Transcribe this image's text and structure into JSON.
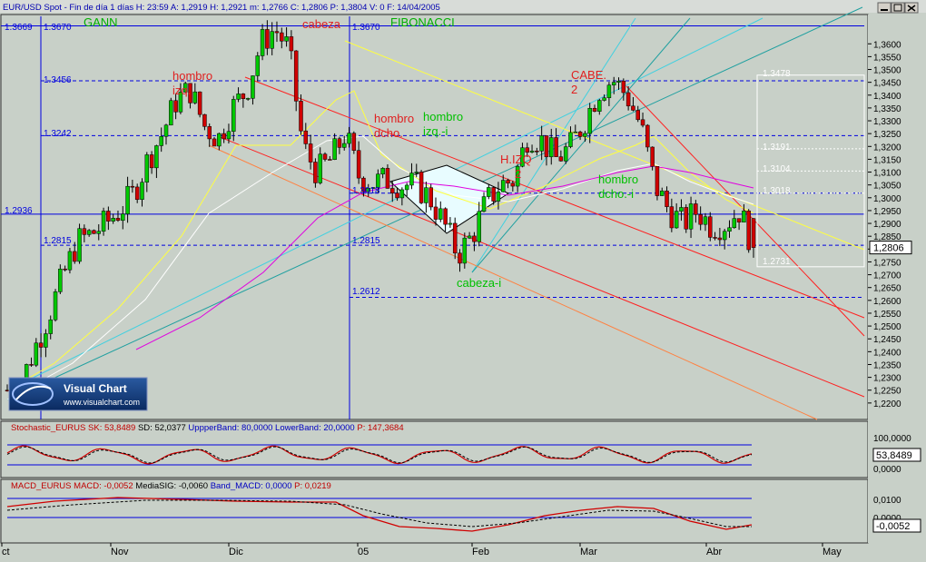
{
  "header": {
    "text": "EUR/USD Spot - Fin de día 1 días H: 23:59 A: 1,2919 H: 1,2921 m: 1,2766 C: 1,2806 P: 1,3804 V: 0 F: 14/04/2005"
  },
  "annotations": {
    "gann": "GANN",
    "fibonacci": "FIBONACCI",
    "cabeza": "cabeza",
    "hombro_izq": [
      "hombro",
      "izq."
    ],
    "hombro_dcho": [
      "hombro",
      "dcho."
    ],
    "hombro_izq_i": [
      "hombro",
      "izq.-i"
    ],
    "hizq2": [
      "H.IZQ",
      "2"
    ],
    "cabe2": [
      "CABE.",
      "2"
    ],
    "hombro_dcho_i": [
      "hombro",
      "dcho.-i"
    ],
    "cabeza_i": "cabeza-i"
  },
  "level_labels": {
    "left": [
      "1.3669",
      "1.3670",
      "1.3456",
      "1.3242",
      "1.2936",
      "1.2815"
    ],
    "middle": [
      "1.3670",
      "1.3018",
      "1.2815",
      "1.2612"
    ],
    "right": [
      "1.3478",
      "1.3191",
      "1.3104",
      "1.3018",
      "1.2731"
    ]
  },
  "logo": {
    "title": "Visual Chart",
    "url": "www.visualchart.com"
  },
  "stoch": {
    "label_name": "Stochastic_EURUS",
    "sk_label": "SK:",
    "sk_value": "53,8489",
    "sd_label": "SD:",
    "sd_value": "52,0377",
    "ub_label": "UppperBand:",
    "ub_value": "80,0000",
    "lb_label": "LowerBand:",
    "lb_value": "20,0000",
    "p_label": "P:",
    "p_value": "147,3684",
    "axis": [
      "100,0000",
      "0,0000"
    ],
    "current": "53,8489"
  },
  "macd": {
    "label_name": "MACD_EURUS",
    "macd_label": "MACD:",
    "macd_value": "-0,0052",
    "sig_label": "MediaSIG:",
    "sig_value": "-0,0060",
    "band_label": "Band_MACD:",
    "band_value": "0,0000",
    "p_label": "P:",
    "p_value": "0,0219",
    "axis": [
      "0,0100",
      "0,0000"
    ],
    "current": "-0,0052"
  },
  "colors": {
    "chart_bg": "#c8d0c8",
    "bull": "#00c800",
    "bear": "#d00000",
    "grid_blue": "#0000e0",
    "yellow": "#ffff40",
    "white": "#ffffff",
    "magenta": "#e000e0",
    "red_channel": "#ff2020",
    "orange_channel": "#ff8040",
    "teal": "#20a0a0",
    "cyan": "#40d0e0"
  },
  "chart_data": {
    "type": "candlestick",
    "title": "EUR/USD Spot - Fin de día",
    "ylim": [
      1.215,
      1.37
    ],
    "y_ticks": [
      "1,3600",
      "1,3550",
      "1,3500",
      "1,3450",
      "1,3400",
      "1,3350",
      "1,3300",
      "1,3250",
      "1,3200",
      "1,3150",
      "1,3100",
      "1,3050",
      "1,3000",
      "1,2950",
      "1,2900",
      "1,2850",
      "1,2800",
      "1,2750",
      "1,2700",
      "1,2650",
      "1,2600",
      "1,2550",
      "1,2500",
      "1,2450",
      "1,2400",
      "1,2350",
      "1,2300",
      "1,2250",
      "1,2200"
    ],
    "current_price": "1,2806",
    "x_labels": [
      "ct",
      "Nov",
      "Dic",
      "05",
      "Feb",
      "Mar",
      "Abr",
      "May"
    ],
    "last_bar": {
      "open": 1.2919,
      "high": 1.2921,
      "low": 1.2766,
      "close": 1.2806,
      "date": "14/04/2005"
    },
    "horizontal_levels": [
      1.367,
      1.3456,
      1.3242,
      1.2936,
      1.2815,
      1.2612
    ],
    "close_path": [
      1.225,
      1.228,
      1.242,
      1.255,
      1.27,
      1.283,
      1.286,
      1.29,
      1.295,
      1.302,
      1.315,
      1.325,
      1.338,
      1.342,
      1.328,
      1.323,
      1.335,
      1.342,
      1.36,
      1.366,
      1.358,
      1.32,
      1.31,
      1.315,
      1.325,
      1.308,
      1.306,
      1.307,
      1.305,
      1.305,
      1.3,
      1.29,
      1.278,
      1.285,
      1.298,
      1.305,
      1.307,
      1.325,
      1.322,
      1.315,
      1.32,
      1.33,
      1.342,
      1.346,
      1.34,
      1.328,
      1.305,
      1.295,
      1.29,
      1.295,
      1.289,
      1.29,
      1.295,
      1.2806
    ]
  }
}
